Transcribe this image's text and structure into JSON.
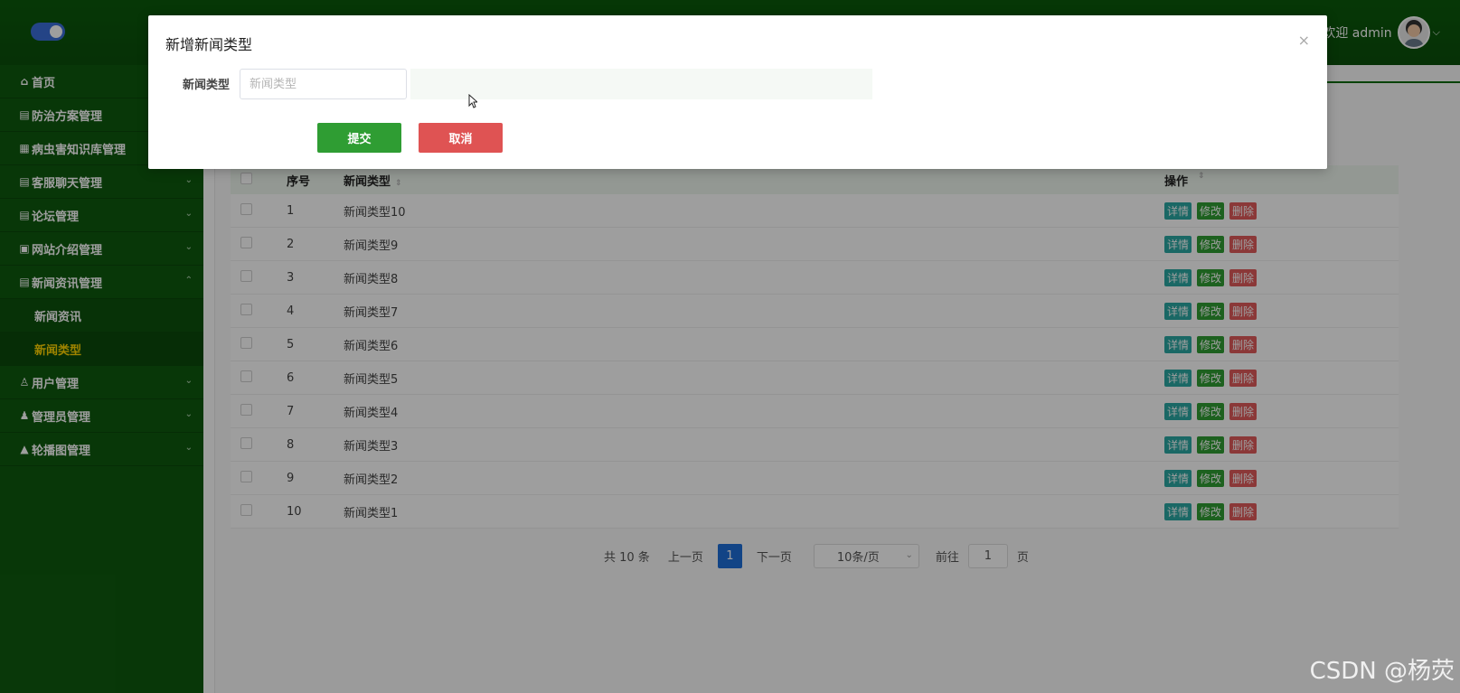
{
  "header": {
    "welcome_text": "欢迎 admin",
    "chevron": "⌵"
  },
  "sidebar": {
    "items": [
      {
        "icon": "⌂",
        "label": "首页",
        "arrow": ""
      },
      {
        "icon": "▤",
        "label": "防治方案管理",
        "arrow": ""
      },
      {
        "icon": "▦",
        "label": "病虫害知识库管理",
        "arrow": ""
      },
      {
        "icon": "▤",
        "label": "客服聊天管理",
        "arrow": "⌄"
      },
      {
        "icon": "▤",
        "label": "论坛管理",
        "arrow": "⌄"
      },
      {
        "icon": "▣",
        "label": "网站介绍管理",
        "arrow": "⌄"
      },
      {
        "icon": "▤",
        "label": "新闻资讯管理",
        "arrow": "⌃"
      }
    ],
    "sub_items": [
      {
        "label": "新闻资讯",
        "active": false
      },
      {
        "label": "新闻类型",
        "active": true
      }
    ],
    "items_after": [
      {
        "icon": "♙",
        "label": "用户管理",
        "arrow": "⌄"
      },
      {
        "icon": "♟",
        "label": "管理员管理",
        "arrow": "⌄"
      },
      {
        "icon": "▲",
        "label": "轮播图管理",
        "arrow": "⌄"
      }
    ]
  },
  "table": {
    "headers": {
      "no": "序号",
      "type": "新闻类型",
      "op": "操作",
      "sort_icon": "⇕"
    },
    "rows": [
      {
        "no": "1",
        "type": "新闻类型10"
      },
      {
        "no": "2",
        "type": "新闻类型9"
      },
      {
        "no": "3",
        "type": "新闻类型8"
      },
      {
        "no": "4",
        "type": "新闻类型7"
      },
      {
        "no": "5",
        "type": "新闻类型6"
      },
      {
        "no": "6",
        "type": "新闻类型5"
      },
      {
        "no": "7",
        "type": "新闻类型4"
      },
      {
        "no": "8",
        "type": "新闻类型3"
      },
      {
        "no": "9",
        "type": "新闻类型2"
      },
      {
        "no": "10",
        "type": "新闻类型1"
      }
    ],
    "actions": {
      "detail": "详情",
      "edit": "修改",
      "delete": "删除"
    }
  },
  "pager": {
    "total": "共 10 条",
    "prev": "上一页",
    "current": "1",
    "next": "下一页",
    "page_size": "10条/页",
    "goto_label": "前往",
    "goto_value": "1",
    "page_suffix": "页"
  },
  "dialog": {
    "title": "新增新闻类型",
    "close": "×",
    "field_label": "新闻类型",
    "field_placeholder": "新闻类型",
    "field_value": "",
    "submit": "提交",
    "cancel": "取消"
  },
  "watermark": "CSDN @杨荧",
  "colors": {
    "header_bg": "#0b5a0b",
    "sidebar_bg": "#0e5a0e",
    "active_submenu": "#ffd400",
    "btn_submit": "#2f9d33",
    "btn_cancel": "#df5353",
    "btn_detail": "#2aa8a3",
    "pager_active": "#1e6fd9"
  }
}
